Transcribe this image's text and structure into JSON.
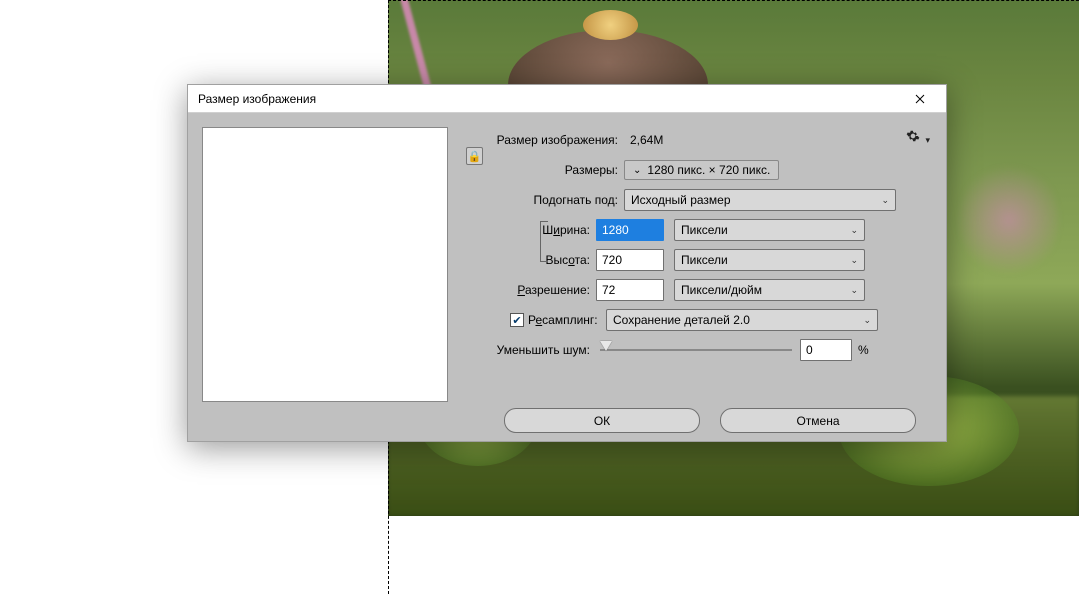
{
  "dialog": {
    "title": "Размер изображения",
    "size_label": "Размер изображения:",
    "size_value": "2,64M",
    "dimensions_label": "Размеры:",
    "dimensions_value": "1280 пикс.  ×  720 пикс.",
    "fit_label": "Подогнать под:",
    "fit_value": "Исходный размер",
    "width_label_pre": "Ш",
    "width_label_hot": "и",
    "width_label_post": "рина:",
    "width_value": "1280",
    "width_unit": "Пиксели",
    "height_label_pre": "Выс",
    "height_label_hot": "о",
    "height_label_post": "та:",
    "height_value": "720",
    "height_unit": "Пиксели",
    "resolution_label_pre": "",
    "resolution_label_hot": "Р",
    "resolution_label_post": "азрешение:",
    "resolution_value": "72",
    "resolution_unit": "Пиксели/дюйм",
    "resample_label_pre": "Р",
    "resample_label_hot": "е",
    "resample_label_post": "самплинг:",
    "resample_checked": true,
    "resample_method": "Сохранение деталей 2.0",
    "noise_label": "Уменьшить шум:",
    "noise_value": "0",
    "noise_unit": "%",
    "ok": "ОК",
    "cancel": "Отмена"
  }
}
